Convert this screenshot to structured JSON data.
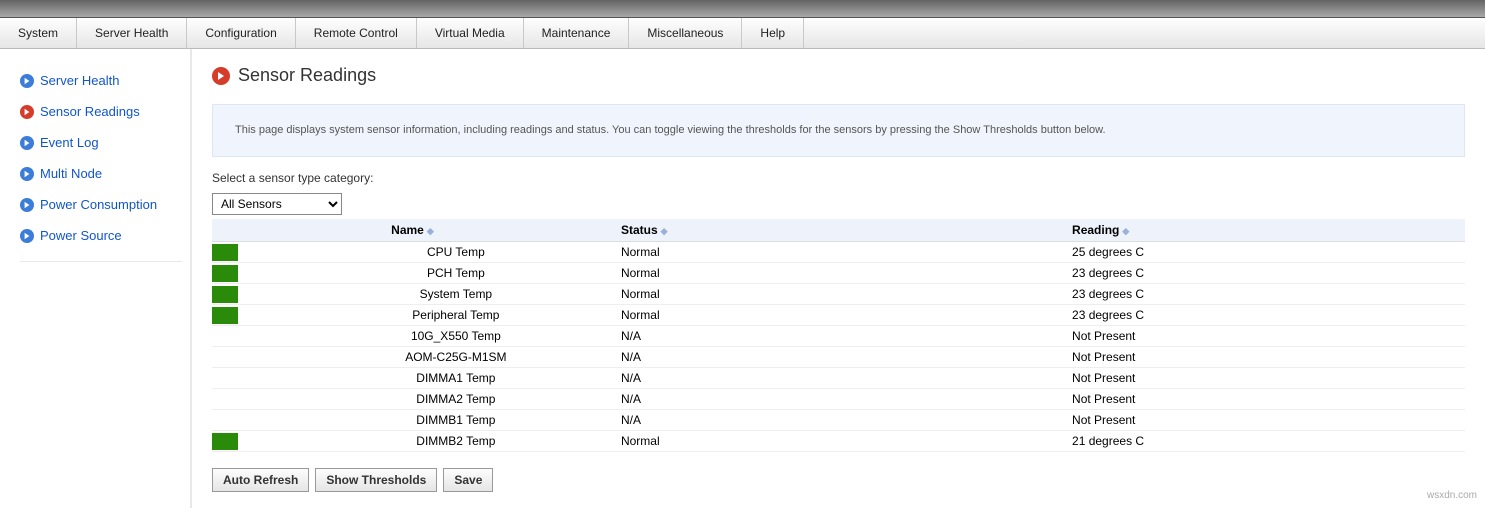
{
  "menubar": [
    "System",
    "Server Health",
    "Configuration",
    "Remote Control",
    "Virtual Media",
    "Maintenance",
    "Miscellaneous",
    "Help"
  ],
  "sidebar": {
    "items": [
      {
        "label": "Server Health",
        "active": false
      },
      {
        "label": "Sensor Readings",
        "active": true
      },
      {
        "label": "Event Log",
        "active": false
      },
      {
        "label": "Multi Node",
        "active": false
      },
      {
        "label": "Power Consumption",
        "active": false
      },
      {
        "label": "Power Source",
        "active": false
      }
    ]
  },
  "page": {
    "title": "Sensor Readings",
    "info": "This page displays system sensor information, including readings and status. You can toggle viewing the thresholds for the sensors by pressing the Show Thresholds button below.",
    "select_label": "Select a sensor type category:",
    "select_value": "All Sensors"
  },
  "table": {
    "headers": {
      "name": "Name",
      "status": "Status",
      "reading": "Reading"
    },
    "rows": [
      {
        "swatch": "green",
        "name": "CPU Temp",
        "status": "Normal",
        "reading": "25 degrees C"
      },
      {
        "swatch": "green",
        "name": "PCH Temp",
        "status": "Normal",
        "reading": "23 degrees C"
      },
      {
        "swatch": "green",
        "name": "System Temp",
        "status": "Normal",
        "reading": "23 degrees C"
      },
      {
        "swatch": "green",
        "name": "Peripheral Temp",
        "status": "Normal",
        "reading": "23 degrees C"
      },
      {
        "swatch": "",
        "name": "10G_X550 Temp",
        "status": "N/A",
        "reading": "Not Present"
      },
      {
        "swatch": "",
        "name": "AOM-C25G-M1SM",
        "status": "N/A",
        "reading": "Not Present"
      },
      {
        "swatch": "",
        "name": "DIMMA1 Temp",
        "status": "N/A",
        "reading": "Not Present"
      },
      {
        "swatch": "",
        "name": "DIMMA2 Temp",
        "status": "N/A",
        "reading": "Not Present"
      },
      {
        "swatch": "",
        "name": "DIMMB1 Temp",
        "status": "N/A",
        "reading": "Not Present"
      },
      {
        "swatch": "green",
        "name": "DIMMB2 Temp",
        "status": "Normal",
        "reading": "21 degrees C"
      }
    ]
  },
  "buttons": {
    "auto_refresh": "Auto Refresh",
    "show_thresholds": "Show Thresholds",
    "save": "Save"
  },
  "watermark": "wsxdn.com"
}
